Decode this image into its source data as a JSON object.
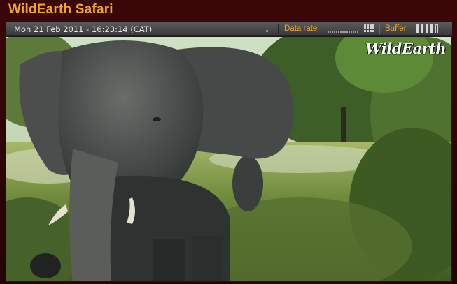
{
  "app": {
    "title": "WildEarth Safari"
  },
  "toolbar": {
    "datetime": "Mon 21 Feb 2011 - 16:23:14 (CAT)",
    "data_rate_label": "Data rate",
    "buffer_label": "Buffer",
    "buffer_level": "4 of 5"
  },
  "video": {
    "watermark": "WildEarth"
  },
  "colors": {
    "accent": "#f0a52a",
    "frame": "#2a0404",
    "toolbar": "#4a4a4a"
  }
}
